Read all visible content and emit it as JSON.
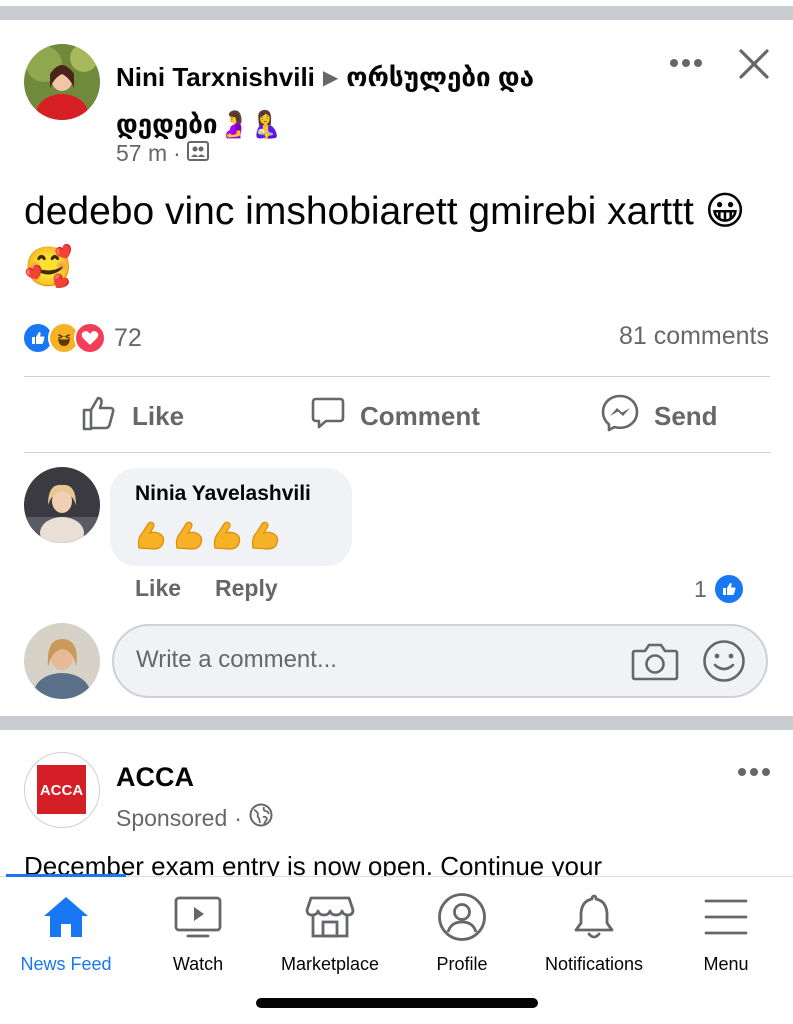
{
  "colors": {
    "accent": "#1877f2",
    "secondary_text": "#65676b",
    "divider": "#c9ccd1",
    "bubble": "#f0f2f5",
    "like_blue": "#1877f2",
    "love_red": "#f33e58",
    "haha_yellow": "#f7b125"
  },
  "post": {
    "author": "Nini Tarxnishvili",
    "group": "ორსულები და დედები🤰🤱",
    "time": "57 m",
    "privacy_icon": "group-icon",
    "text": "dedebo vinc imshobiarett gmirebi xarttt 😀🥰",
    "reactions_count": "72",
    "comments_count": "81 comments",
    "actions": {
      "like": "Like",
      "comment": "Comment",
      "send": "Send"
    }
  },
  "comment": {
    "author": "Ninia Yavelashvili",
    "text": "💪💪💪💪",
    "actions": {
      "like": "Like",
      "reply": "Reply"
    },
    "likes": "1"
  },
  "composer": {
    "placeholder": "Write a comment..."
  },
  "ad": {
    "name": "ACCA",
    "logo_text": "ACCA",
    "sponsored": "Sponsored",
    "text": "December exam entry is now open. Continue your"
  },
  "tabs": [
    {
      "label": "News Feed",
      "icon": "home-icon",
      "active": true
    },
    {
      "label": "Watch",
      "icon": "watch-icon",
      "active": false
    },
    {
      "label": "Marketplace",
      "icon": "marketplace-icon",
      "active": false
    },
    {
      "label": "Profile",
      "icon": "profile-icon",
      "active": false
    },
    {
      "label": "Notifications",
      "icon": "bell-icon",
      "active": false
    },
    {
      "label": "Menu",
      "icon": "menu-icon",
      "active": false
    }
  ]
}
